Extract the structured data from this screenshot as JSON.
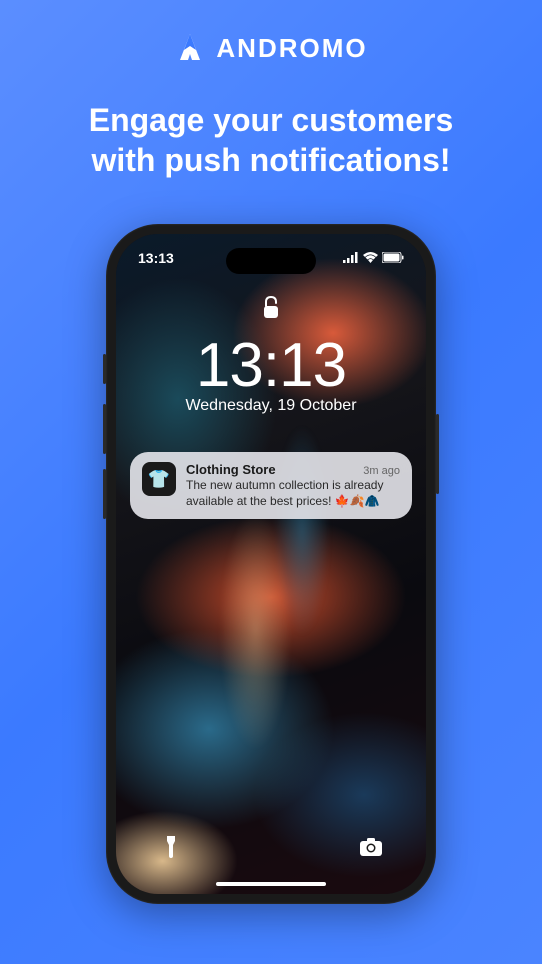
{
  "brand": "ANDROMO",
  "headline_line1": "Engage your customers",
  "headline_line2": "with push notifications!",
  "phone": {
    "status_time": "13:13",
    "clock_time": "13:13",
    "clock_date": "Wednesday, 19 October",
    "notification": {
      "app": "Clothing Store",
      "time": "3m ago",
      "message": "The new autumn collection is already available at the best prices! 🍁🍂🧥"
    }
  }
}
